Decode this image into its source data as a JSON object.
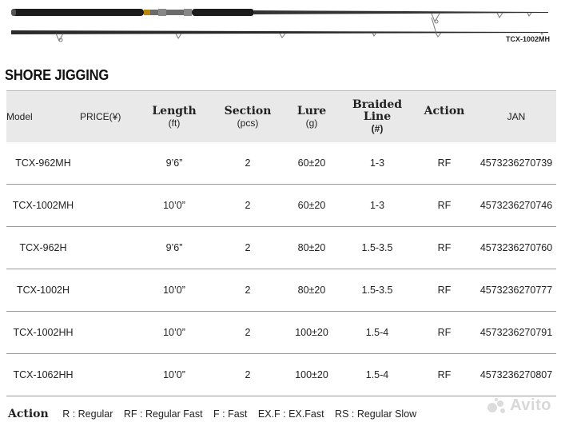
{
  "rod": {
    "model_label": "TCX-1002MH"
  },
  "section_title": "SHORE JIGGING",
  "table": {
    "headers": {
      "model": "Model",
      "price": "PRICE(¥)",
      "length": "Length",
      "length_unit": "(ft)",
      "section": "Section",
      "section_unit": "(pcs)",
      "lure": "Lure",
      "lure_unit": "(g)",
      "braided_1": "Braided",
      "braided_2": "Line",
      "braided_unit": "(#)",
      "action": "Action",
      "jan": "JAN"
    },
    "rows": [
      {
        "model": "TCX-962MH",
        "price": "",
        "length": "9’6”",
        "section": "2",
        "lure": "60±20",
        "line": "1-3",
        "action": "RF",
        "jan": "4573236270739"
      },
      {
        "model": "TCX-1002MH",
        "price": "",
        "length": "10’0”",
        "section": "2",
        "lure": "60±20",
        "line": "1-3",
        "action": "RF",
        "jan": "4573236270746"
      },
      {
        "model": "TCX-962H",
        "price": "",
        "length": "9’6”",
        "section": "2",
        "lure": "80±20",
        "line": "1.5-3.5",
        "action": "RF",
        "jan": "4573236270760"
      },
      {
        "model": "TCX-1002H",
        "price": "",
        "length": "10’0”",
        "section": "2",
        "lure": "80±20",
        "line": "1.5-3.5",
        "action": "RF",
        "jan": "4573236270777"
      },
      {
        "model": "TCX-1002HH",
        "price": "",
        "length": "10’0”",
        "section": "2",
        "lure": "100±20",
        "line": "1.5-4",
        "action": "RF",
        "jan": "4573236270791"
      },
      {
        "model": "TCX-1062HH",
        "price": "",
        "length": "10’0”",
        "section": "2",
        "lure": "100±20",
        "line": "1.5-4",
        "action": "RF",
        "jan": "4573236270807"
      }
    ]
  },
  "legend": {
    "title": "Action",
    "items": [
      "R : Regular",
      "RF : Regular Fast",
      "F : Fast",
      "EX.F : EX.Fast",
      "RS : Regular Slow"
    ]
  },
  "watermark": "Avito"
}
